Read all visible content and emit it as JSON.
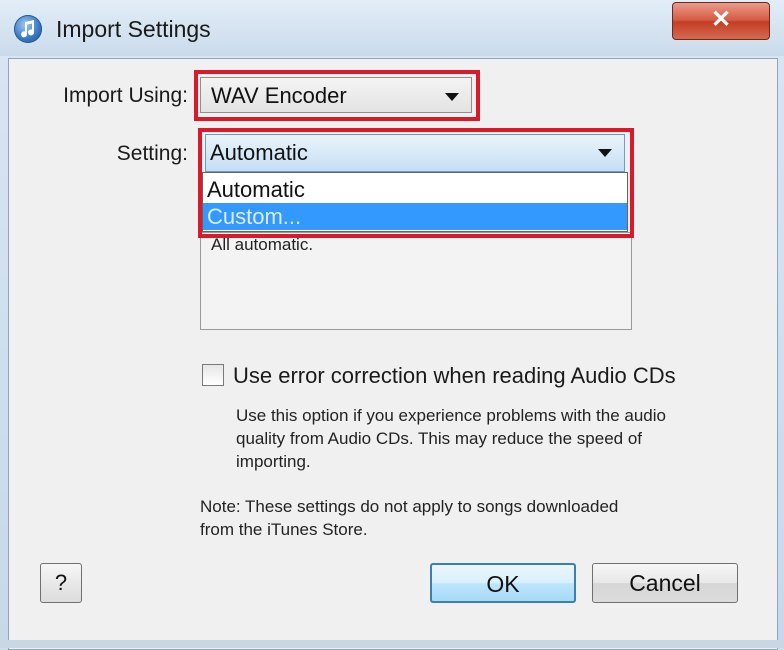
{
  "window": {
    "title": "Import Settings",
    "close_label": "✕"
  },
  "import_using": {
    "label": "Import Using:",
    "value": "WAV Encoder"
  },
  "setting": {
    "label": "Setting:",
    "value": "Automatic",
    "options": [
      "Automatic",
      "Custom..."
    ],
    "highlighted_option": "Custom..."
  },
  "description": {
    "text": "All automatic."
  },
  "error_correction": {
    "label": "Use error correction when reading Audio CDs",
    "checked": false,
    "help_lines": [
      "Use this option if you experience problems with the audio",
      "quality from Audio CDs.  This may reduce the speed of",
      "importing."
    ]
  },
  "note": {
    "lines": [
      "Note: These settings do not apply to songs downloaded",
      "from the iTunes Store."
    ]
  },
  "buttons": {
    "help": "?",
    "ok": "OK",
    "cancel": "Cancel"
  },
  "colors": {
    "highlight_border": "#d91a2a",
    "selection": "#3399ff",
    "close_button": "#c23e26"
  }
}
